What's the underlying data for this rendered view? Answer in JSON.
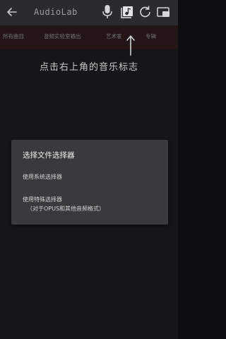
{
  "appbar": {
    "title": "AudioLab",
    "icons": [
      "back-icon",
      "mic-icon",
      "music-icon",
      "refresh-icon",
      "cast-icon"
    ]
  },
  "tabs": [
    "所有曲目",
    "音频实验室输出",
    "艺术家",
    "专辑"
  ],
  "hint": "点击右上角的音乐标志",
  "dialog": {
    "title": "选择文件选择器",
    "option_system": "使用系统选择器",
    "option_special": "使用特殊选择器",
    "option_special_note": "（对于OPUS和其他音频格式）"
  },
  "colors": {
    "background": "#1b1b1f",
    "appbar": "#2a2a2f",
    "tab_strip": "#2c1a1b",
    "dialog": "#3a3a3d"
  }
}
